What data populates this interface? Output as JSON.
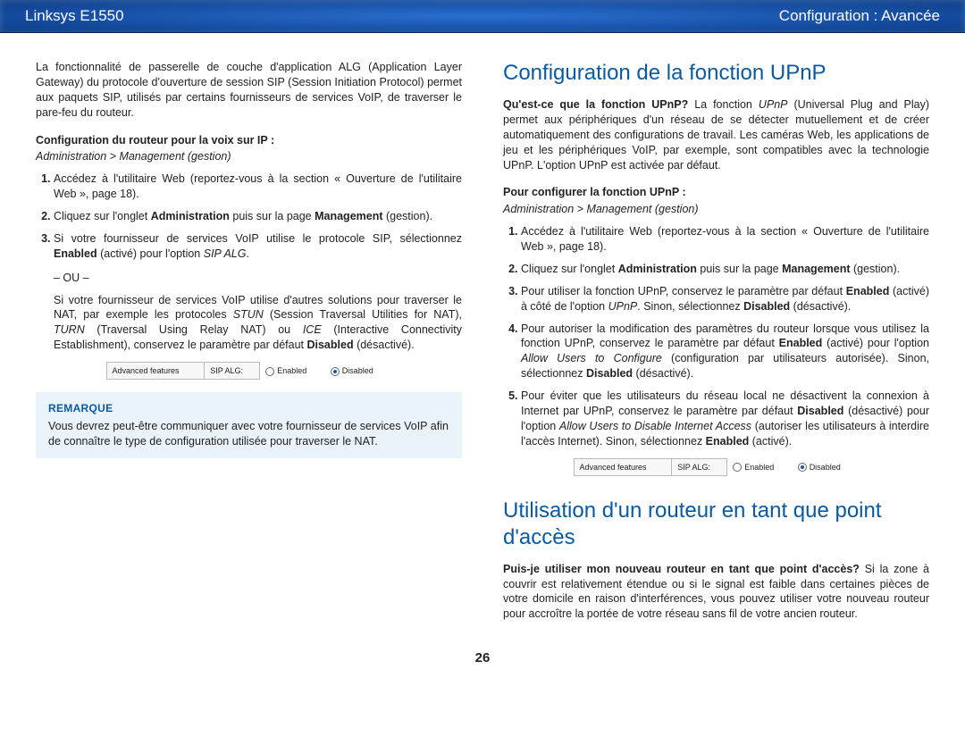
{
  "header": {
    "left": "Linksys E1550",
    "right": "Configuration : Avancée"
  },
  "left": {
    "intro": "La fonctionnalité de passerelle de couche d'application ALG (Application Layer Gateway) du protocole d'ouverture de session SIP (Session Initiation Protocol) permet aux paquets SIP, utilisés par certains fournisseurs de services VoIP, de traverser le pare-feu du routeur.",
    "subhead": "Configuration du routeur pour la voix sur IP :",
    "navpath": "Administration > Management (gestion)",
    "step1": "Accédez à l'utilitaire Web (reportez-vous à la section « Ouverture de l'utilitaire Web », page 18).",
    "step2a": "Cliquez sur l'onglet ",
    "step2b": "Administration",
    "step2c": " puis sur la page ",
    "step2d": "Management",
    "step2e": " (gestion).",
    "step3a": "Si votre fournisseur de services VoIP utilise le protocole SIP, sélectionnez ",
    "step3b": "Enabled",
    "step3c": " (activé) pour l'option ",
    "step3d": "SIP ALG",
    "step3e": ".",
    "or": "– OU –",
    "cont_a": "Si votre fournisseur de services VoIP utilise d'autres solutions pour traverser le NAT, par exemple les protocoles ",
    "cont_b": "STUN",
    "cont_c": " (Session Traversal Utilities for NAT), ",
    "cont_d": "TURN",
    "cont_e": " (Traversal Using Relay NAT) ou ",
    "cont_f": "ICE",
    "cont_g": " (Interactive Connectivity Establishment), conservez le paramètre par défaut ",
    "cont_h": "Disabled",
    "cont_i": " (désactivé).",
    "ui": {
      "col1": "Advanced features",
      "col2": "SIP ALG:",
      "opt_en": "Enabled",
      "opt_dis": "Disabled"
    },
    "note": {
      "title": "REMARQUE",
      "body": "Vous devrez peut-être communiquer avec votre fournisseur de services VoIP afin de connaître le type de configuration utilisée pour traverser le NAT."
    }
  },
  "right": {
    "h1": "Configuration de la fonction UPnP",
    "intro_a": "Qu'est-ce que la fonction UPnP?",
    "intro_b": " La fonction ",
    "intro_c": "UPnP",
    "intro_d": " (Universal Plug and Play) permet aux périphériques d'un réseau de se détecter mutuellement et de créer automatiquement des configurations de travail. Les caméras Web, les applications de jeu et les périphériques VoIP, par exemple, sont compatibles avec la technologie UPnP. L'option UPnP est activée par défaut.",
    "subhead": "Pour configurer la fonction UPnP :",
    "navpath": "Administration > Management (gestion)",
    "s1": "Accédez à l'utilitaire Web (reportez-vous à la section « Ouverture de l'utilitaire Web », page 18).",
    "s2a": "Cliquez sur l'onglet ",
    "s2b": "Administration",
    "s2c": " puis sur la page ",
    "s2d": "Management",
    "s2e": " (gestion).",
    "s3a": "Pour utiliser la fonction UPnP, conservez le paramètre par défaut ",
    "s3b": "Enabled",
    "s3c": " (activé) à côté de l'option ",
    "s3d": "UPnP",
    "s3e": ". Sinon, sélectionnez ",
    "s3f": "Disabled",
    "s3g": " (désactivé).",
    "s4a": "Pour autoriser la modification des paramètres du routeur lorsque vous utilisez la fonction UPnP, conservez le paramètre par défaut ",
    "s4b": "Enabled",
    "s4c": " (activé) pour l'option ",
    "s4d": "Allow Users to Configure",
    "s4e": " (configuration par utilisateurs autorisée). Sinon, sélectionnez ",
    "s4f": "Disabled",
    "s4g": " (désactivé).",
    "s5a": "Pour éviter que les utilisateurs du réseau local ne désactivent la connexion à Internet par UPnP, conservez le paramètre par défaut ",
    "s5b": "Disabled",
    "s5c": " (désactivé) pour l'option ",
    "s5d": "Allow Users to Disable Internet Access",
    "s5e": " (autoriser les utilisateurs à interdire l'accès Internet). Sinon, sélectionnez ",
    "s5f": "Enabled",
    "s5g": " (activé).",
    "ui": {
      "col1": "Advanced features",
      "col2": "SIP ALG:",
      "opt_en": "Enabled",
      "opt_dis": "Disabled"
    },
    "h2": "Utilisation d'un routeur en tant que point d'accès",
    "ap_q": "Puis-je utiliser mon nouveau routeur en tant que point d'accès?",
    "ap_t": " Si la zone à couvrir est relativement étendue ou si le signal est faible dans certaines pièces de votre domicile en raison d'interférences, vous pouvez utiliser votre nouveau routeur pour accroître la portée de votre réseau sans fil de votre ancien routeur."
  },
  "page_number": "26"
}
